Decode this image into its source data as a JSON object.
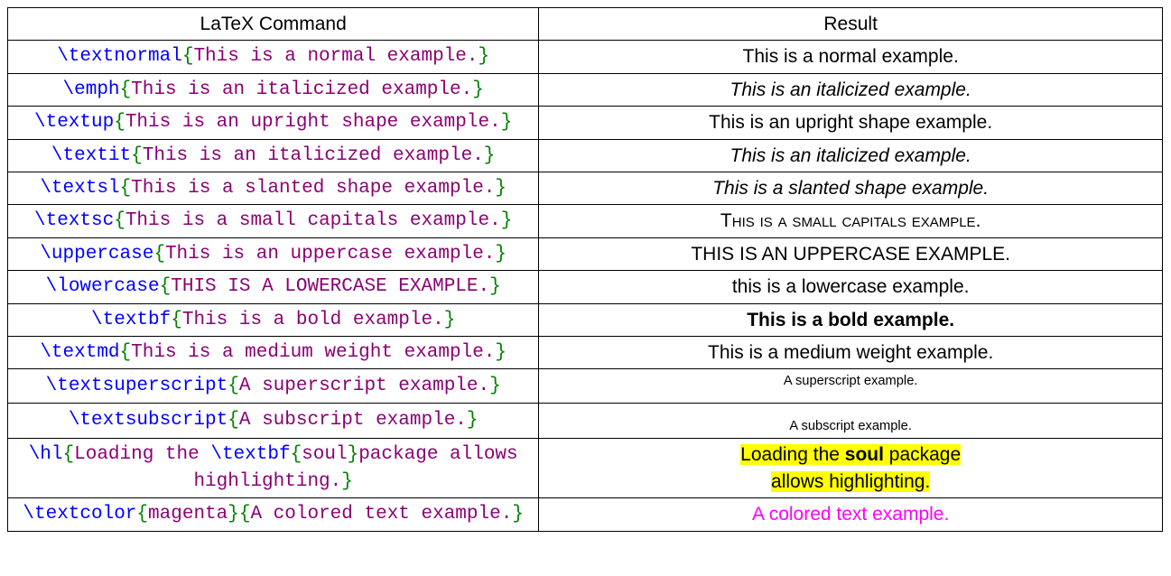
{
  "header": {
    "col1": "LaTeX Command",
    "col2": "Result"
  },
  "rows": [
    {
      "cmd": "\\textnormal",
      "arg": "This is a normal example.",
      "result": "This is a normal example.",
      "style": "r-normal"
    },
    {
      "cmd": "\\emph",
      "arg": "This is an italicized example.",
      "result": "This is an italicized example.",
      "style": "r-italic"
    },
    {
      "cmd": "\\textup",
      "arg": "This is an upright shape example.",
      "result": "This is an upright shape example.",
      "style": "r-upright"
    },
    {
      "cmd": "\\textit",
      "arg": "This is an italicized example.",
      "result": "This is an italicized example.",
      "style": "r-italic"
    },
    {
      "cmd": "\\textsl",
      "arg": "This is a slanted shape example.",
      "result": "This is a slanted shape example.",
      "style": "r-slanted"
    },
    {
      "cmd": "\\textsc",
      "arg": "This is a small capitals example.",
      "result": "This is a small capitals example.",
      "style": "r-smallcaps"
    },
    {
      "cmd": "\\uppercase",
      "arg": "This is an uppercase example.",
      "result": "THIS IS AN UPPERCASE EXAMPLE.",
      "style": "r-uppercase"
    },
    {
      "cmd": "\\lowercase",
      "arg": "THIS IS A LOWERCASE EXAMPLE.",
      "result": "this is a lowercase example.",
      "style": "r-lowercase"
    },
    {
      "cmd": "\\textbf",
      "arg": "This is a bold example.",
      "result": "This is a bold example.",
      "style": "r-bold"
    },
    {
      "cmd": "\\textmd",
      "arg": "This is a medium weight example.",
      "result": "This is a medium weight example.",
      "style": "r-medium"
    },
    {
      "cmd": "\\textsuperscript",
      "arg": "A superscript example.",
      "result": "A superscript example.",
      "style": "r-super"
    },
    {
      "cmd": "\\textsubscript",
      "arg": "A subscript example.",
      "result": "A subscript example.",
      "style": "r-sub"
    }
  ],
  "hl_row": {
    "cmd1": "\\hl",
    "arg1a": "Loading the ",
    "cmd2": "\\textbf",
    "arg2": "soul",
    "arg1b": "package allows highlighting.",
    "result_line1_a": "Loading the ",
    "result_line1_b": "soul",
    "result_line1_c": " package",
    "result_line2": "allows highlighting."
  },
  "color_row": {
    "cmd": "\\textcolor",
    "color_arg": "magenta",
    "arg": "A colored text example.",
    "result": "A colored text example."
  },
  "chart_data": {
    "type": "table",
    "title": "LaTeX text formatting commands and their rendered results",
    "columns": [
      "LaTeX Command",
      "Result"
    ],
    "rows": [
      [
        "\\textnormal{This is a normal example.}",
        "This is a normal example."
      ],
      [
        "\\emph{This is an italicized example.}",
        "This is an italicized example. (italic)"
      ],
      [
        "\\textup{This is an upright shape example.}",
        "This is an upright shape example."
      ],
      [
        "\\textit{This is an italicized example.}",
        "This is an italicized example. (italic)"
      ],
      [
        "\\textsl{This is a slanted shape example.}",
        "This is a slanted shape example. (slanted/italic)"
      ],
      [
        "\\textsc{This is a small capitals example.}",
        "THIS IS A SMALL CAPITALS EXAMPLE. (small caps)"
      ],
      [
        "\\uppercase{This is an uppercase example.}",
        "THIS IS AN UPPERCASE EXAMPLE."
      ],
      [
        "\\lowercase{THIS IS A LOWERCASE EXAMPLE.}",
        "this is a lowercase example."
      ],
      [
        "\\textbf{This is a bold example.}",
        "This is a bold example. (bold)"
      ],
      [
        "\\textmd{This is a medium weight example.}",
        "This is a medium weight example."
      ],
      [
        "\\textsuperscript{A superscript example.}",
        "A superscript example. (superscript)"
      ],
      [
        "\\textsubscript{A subscript example.}",
        "A subscript example. (subscript)"
      ],
      [
        "\\hl{Loading the \\textbf{soul}package allows highlighting.}",
        "Loading the soul package allows highlighting. (yellow highlight, 'soul' bold)"
      ],
      [
        "\\textcolor{magenta}{A colored text example.}",
        "A colored text example. (magenta)"
      ]
    ]
  }
}
